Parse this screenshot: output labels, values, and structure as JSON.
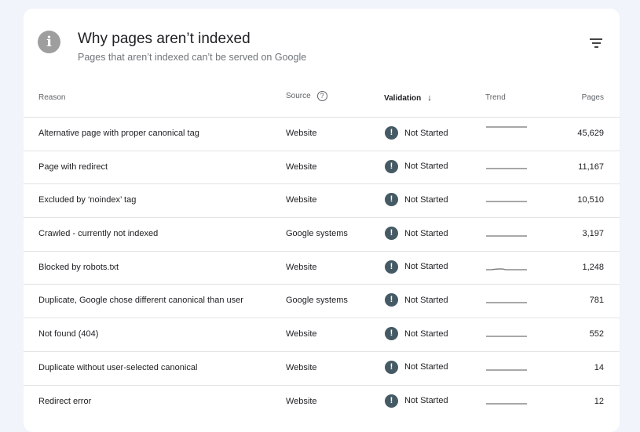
{
  "card": {
    "title": "Why pages aren’t indexed",
    "subtitle": "Pages that aren’t indexed can’t be served on Google"
  },
  "table": {
    "headers": {
      "reason": "Reason",
      "source": "Source",
      "validation": "Validation",
      "trend": "Trend",
      "pages": "Pages"
    },
    "rows": [
      {
        "reason": "Alternative page with proper canonical tag",
        "source": "Website",
        "validation": "Not Started",
        "pages": "45,629"
      },
      {
        "reason": "Page with redirect",
        "source": "Website",
        "validation": "Not Started",
        "pages": "11,167"
      },
      {
        "reason": "Excluded by ‘noindex’ tag",
        "source": "Website",
        "validation": "Not Started",
        "pages": "10,510"
      },
      {
        "reason": "Crawled - currently not indexed",
        "source": "Google systems",
        "validation": "Not Started",
        "pages": "3,197"
      },
      {
        "reason": "Blocked by robots.txt",
        "source": "Website",
        "validation": "Not Started",
        "pages": "1,248"
      },
      {
        "reason": "Duplicate, Google chose different canonical than user",
        "source": "Google systems",
        "validation": "Not Started",
        "pages": "781"
      },
      {
        "reason": "Not found (404)",
        "source": "Website",
        "validation": "Not Started",
        "pages": "552"
      },
      {
        "reason": "Duplicate without user-selected canonical",
        "source": "Website",
        "validation": "Not Started",
        "pages": "14"
      },
      {
        "reason": "Redirect error",
        "source": "Website",
        "validation": "Not Started",
        "pages": "12"
      }
    ]
  }
}
